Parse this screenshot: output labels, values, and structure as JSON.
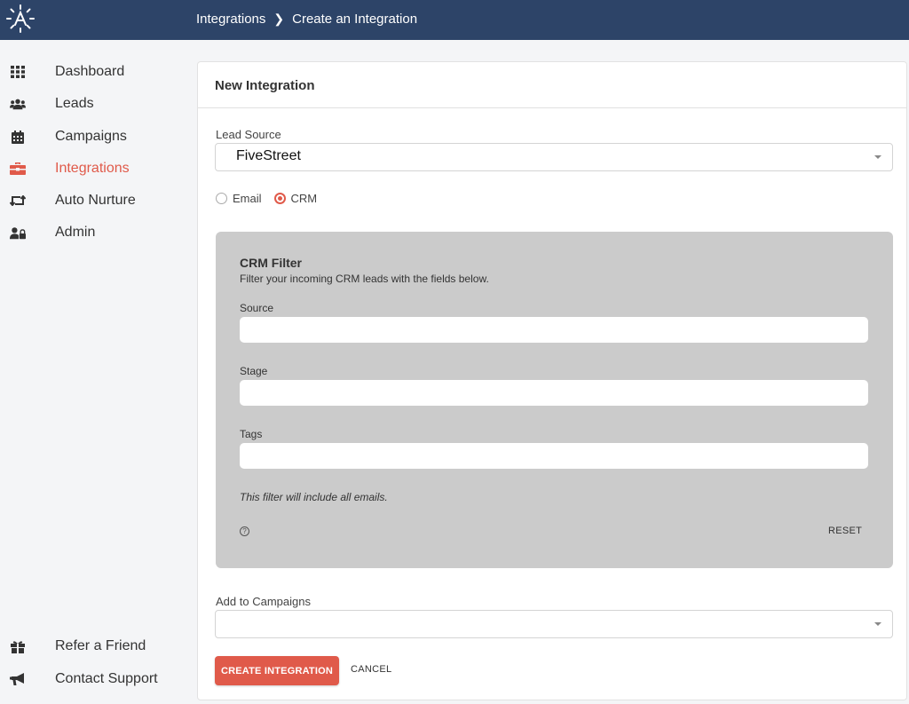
{
  "header": {
    "logo_icon": "sunburst-a-logo",
    "breadcrumb": [
      "Integrations",
      "Create an Integration"
    ],
    "background": "#2d4468"
  },
  "sidebar": {
    "items": [
      {
        "label": "Dashboard",
        "icon": "grid-icon"
      },
      {
        "label": "Leads",
        "icon": "users-icon"
      },
      {
        "label": "Campaigns",
        "icon": "calendar-icon"
      },
      {
        "label": "Integrations",
        "icon": "toolbox-icon",
        "active": true
      },
      {
        "label": "Auto Nurture",
        "icon": "retweet-icon"
      },
      {
        "label": "Admin",
        "icon": "user-lock-icon"
      }
    ],
    "footer_items": [
      {
        "label": "Refer a Friend",
        "icon": "gift-icon"
      },
      {
        "label": "Contact Support",
        "icon": "megaphone-icon"
      }
    ]
  },
  "card": {
    "title": "New Integration",
    "lead_source": {
      "label": "Lead Source",
      "value": "FiveStreet"
    },
    "radio_options": [
      {
        "label": "Email",
        "checked": false
      },
      {
        "label": "CRM",
        "checked": true
      }
    ],
    "crm_filter": {
      "title": "CRM Filter",
      "subtitle": "Filter your incoming CRM leads with the fields below.",
      "fields": [
        {
          "label": "Source",
          "value": ""
        },
        {
          "label": "Stage",
          "value": ""
        },
        {
          "label": "Tags",
          "value": ""
        }
      ],
      "note": "This filter will include all emails.",
      "help_icon": "question-circle-icon",
      "reset_label": "RESET"
    },
    "campaigns": {
      "label": "Add to Campaigns",
      "value": ""
    },
    "create_label": "CREATE INTEGRATION",
    "cancel_label": "CANCEL"
  },
  "colors": {
    "accent": "#e05a4a",
    "panel": "#cbcbcb"
  }
}
